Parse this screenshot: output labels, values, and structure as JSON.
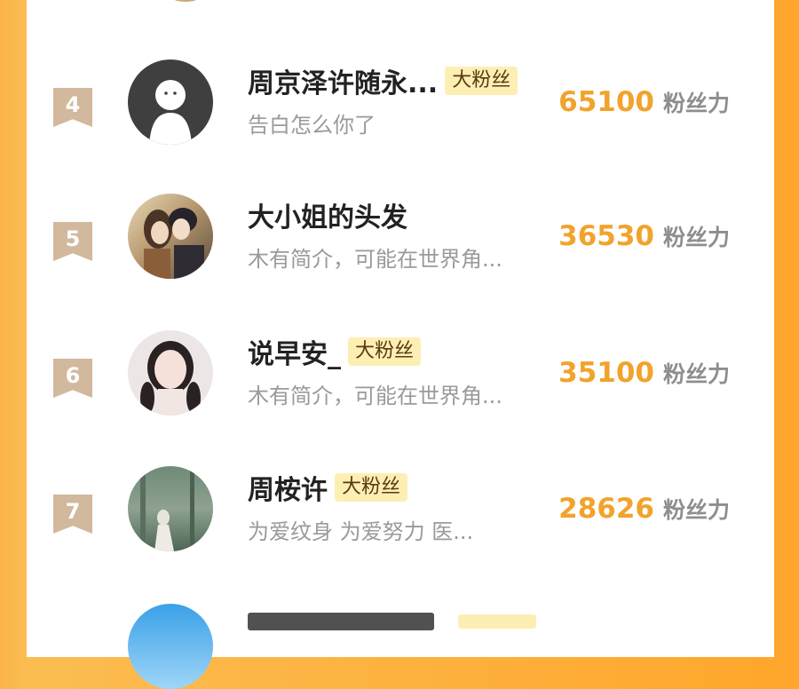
{
  "rows": [
    {
      "rank": "4",
      "name": "周京泽许随永...",
      "badge": "大粉丝",
      "bio": "告白怎么你了",
      "score": "65100",
      "unit": "粉丝力"
    },
    {
      "rank": "5",
      "name": "大小姐的头发",
      "badge": "",
      "bio": "木有简介，可能在世界角...",
      "score": "36530",
      "unit": "粉丝力"
    },
    {
      "rank": "6",
      "name": "说早安_",
      "badge": "大粉丝",
      "bio": "木有简介，可能在世界角...",
      "score": "35100",
      "unit": "粉丝力"
    },
    {
      "rank": "7",
      "name": "周桉许",
      "badge": "大粉丝",
      "bio": "为爱纹身 为爱努力 医...",
      "score": "28626",
      "unit": "粉丝力"
    }
  ]
}
